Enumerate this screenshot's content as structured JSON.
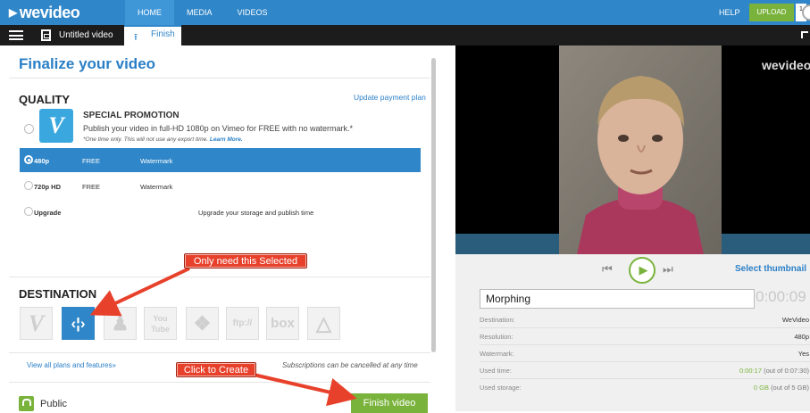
{
  "topbar": {
    "logo": "wevideo",
    "nav": [
      "HOME",
      "MEDIA",
      "VIDEOS"
    ],
    "help": "HELP",
    "upload": "UPLOAD",
    "badge": "1"
  },
  "subbar": {
    "video_title": "Untitled video",
    "finish_tab": "Finish"
  },
  "finalize": {
    "heading": "Finalize your video",
    "quality_heading": "QUALITY",
    "update_payment": "Update payment plan",
    "promo": {
      "title": "SPECIAL PROMOTION",
      "desc": "Publish your video in full-HD 1080p on Vimeo for FREE with no watermark.*",
      "note": "*One time only. This will not use any export time.",
      "learn_more": "Learn More."
    },
    "options": [
      {
        "name": "480p",
        "price": "FREE",
        "extra": "Watermark",
        "selected": true
      },
      {
        "name": "720p HD",
        "price": "FREE",
        "extra": "Watermark",
        "selected": false
      },
      {
        "name": "Upgrade",
        "price": "",
        "extra": "Upgrade your storage and publish time",
        "selected": false
      }
    ],
    "destination_heading": "DESTINATION",
    "destinations": [
      "Vimeo",
      "WeVideo",
      "Dropbox",
      "YouTube",
      "Dropbox",
      "FTP",
      "Box",
      "Google Drive"
    ],
    "destination_glyphs": [
      "V",
      "‹¦›",
      "♟",
      "You Tube",
      "❖",
      "ftp://",
      "box",
      "△"
    ],
    "view_all": "View all plans and features»",
    "subscriptions_note": "Subscriptions can be cancelled at any time",
    "visibility": "Public",
    "finish_button": "Finish video"
  },
  "annotations": {
    "callout_selected": "Only need this Selected",
    "callout_create": "Click to Create"
  },
  "preview": {
    "watermark": "wevideo",
    "select_thumbnail": "Select thumbnail",
    "video_name": "Morphing",
    "duration": "0:00:09",
    "details": [
      {
        "key": "Destination:",
        "value": "WeVideo"
      },
      {
        "key": "Resolution:",
        "value": "480p"
      },
      {
        "key": "Watermark:",
        "value": "Yes"
      },
      {
        "key": "Used time:",
        "value": "0:00:17",
        "value_rest": "(out of 0:07:30)"
      },
      {
        "key": "Used storage:",
        "value": "0 GB",
        "value_rest": "(out of 5 GB)"
      }
    ]
  },
  "colors": {
    "brand_blue": "#2f86c8",
    "accent_green": "#7ab33c",
    "callout_red": "#e8412b"
  }
}
